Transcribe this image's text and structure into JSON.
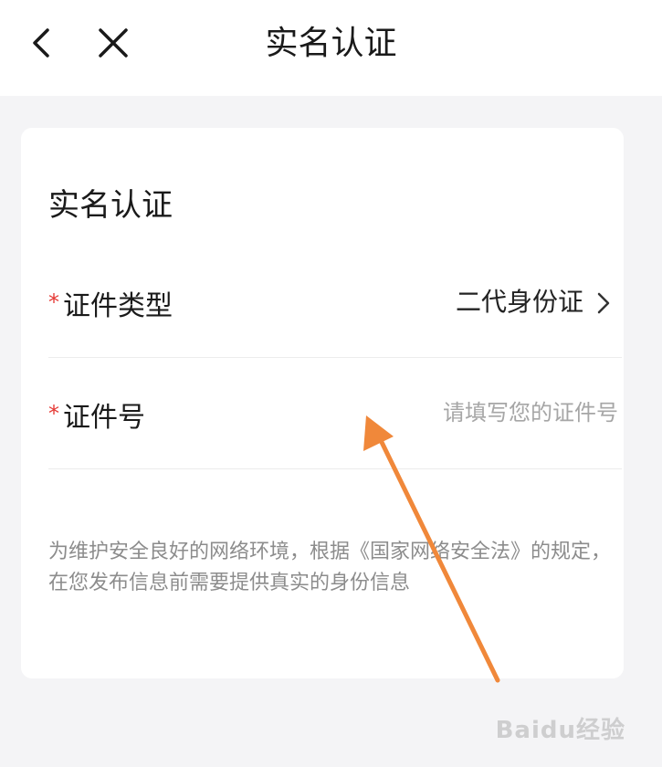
{
  "header": {
    "title": "实名认证",
    "back_icon": "chevron-left-icon",
    "close_icon": "close-icon"
  },
  "card": {
    "title": "实名认证",
    "rows": [
      {
        "required_mark": "*",
        "label": "证件类型",
        "value": "二代身份证",
        "chevron_icon": "chevron-right-icon"
      },
      {
        "required_mark": "*",
        "label": "证件号",
        "value": "",
        "placeholder": "请填写您的证件号"
      }
    ],
    "notice": "为维护安全良好的网络环境，根据《国家网络安全法》的规定，在您发布信息前需要提供真实的身份信息"
  },
  "annotation": {
    "color": "#f0883a"
  },
  "watermark": {
    "text": "Baidu经验"
  },
  "colors": {
    "background": "#f4f4f6",
    "required": "#e53935",
    "placeholder": "#a6a6a6"
  }
}
